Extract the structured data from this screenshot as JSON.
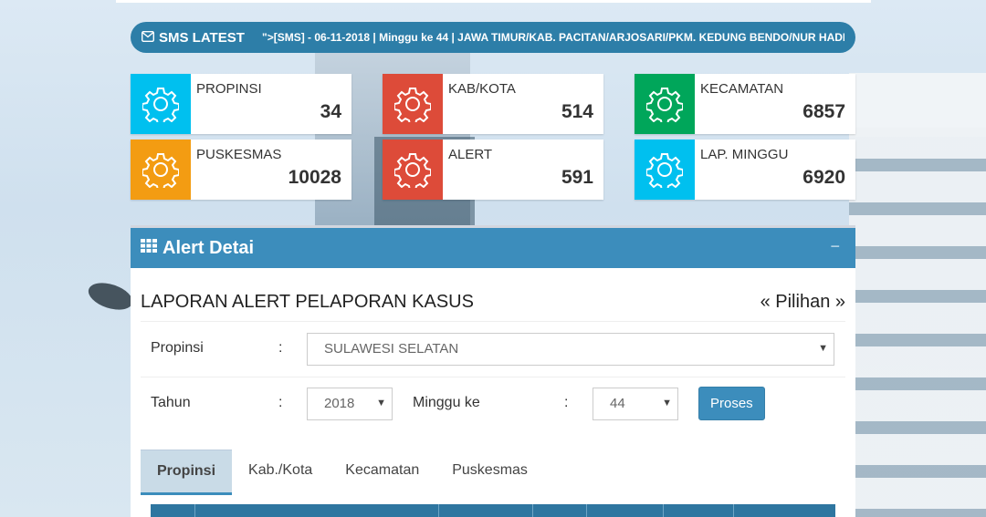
{
  "sms": {
    "label": "SMS LATEST",
    "text": "\">[SMS] - 06-11-2018 | Minggu ke 44 | JAWA TIMUR/KAB. PACITAN/ARJOSARI/PKM. KEDUNG BENDO/NUR HADI SUI"
  },
  "stats": [
    {
      "label": "PROPINSI",
      "value": "34",
      "color": "#00c0ef",
      "icon": "gear-icon"
    },
    {
      "label": "KAB/KOTA",
      "value": "514",
      "color": "#dd4b39",
      "icon": "gear-icon"
    },
    {
      "label": "KECAMATAN",
      "value": "6857",
      "color": "#00a65a",
      "icon": "gear-icon"
    },
    {
      "label": "PUSKESMAS",
      "value": "10028",
      "color": "#f39c12",
      "icon": "gear-icon"
    },
    {
      "label": "ALERT",
      "value": "591",
      "color": "#dd4b39",
      "icon": "gear-icon"
    },
    {
      "label": "LAP. MINGGU",
      "value": "6920",
      "color": "#00c0ef",
      "icon": "gear-icon"
    }
  ],
  "panel": {
    "title": "Alert Detai",
    "collapse": "−",
    "report_title": "LAPORAN ALERT PELAPORAN KASUS",
    "pilihan": "« Pilihan »"
  },
  "form": {
    "propinsi_label": "Propinsi",
    "propinsi_value": "SULAWESI SELATAN",
    "tahun_label": "Tahun",
    "tahun_value": "2018",
    "minggu_label": "Minggu ke",
    "minggu_value": "44",
    "colon": ":",
    "proses_label": "Proses"
  },
  "tabs": [
    "Propinsi",
    "Kab./Kota",
    "Kecamatan",
    "Puskesmas"
  ]
}
